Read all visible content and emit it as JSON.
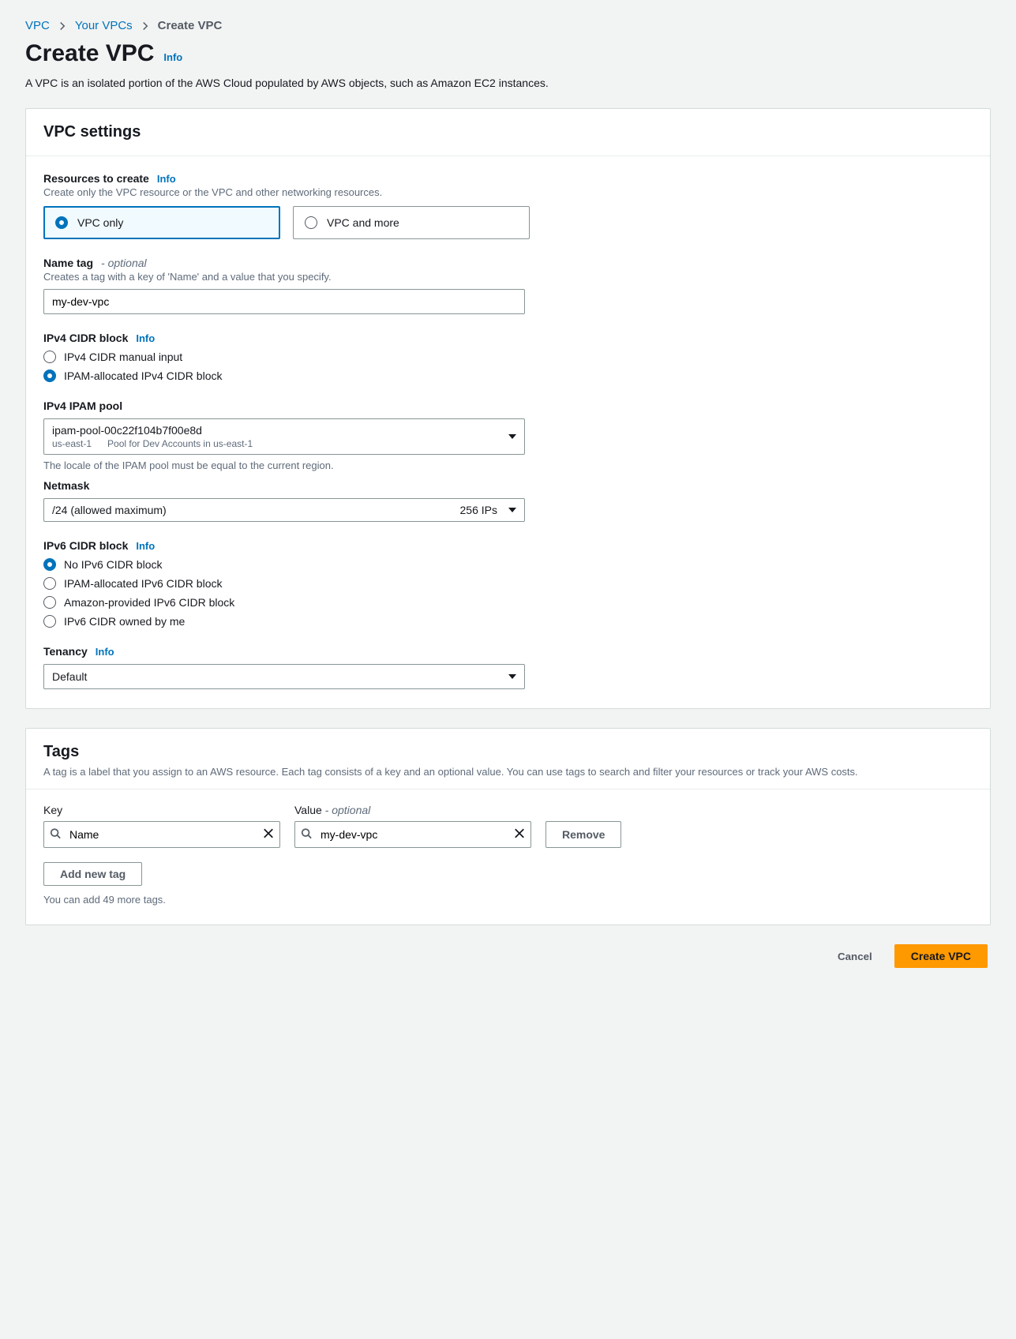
{
  "breadcrumb": {
    "items": [
      "VPC",
      "Your VPCs",
      "Create VPC"
    ]
  },
  "header": {
    "title": "Create VPC",
    "info": "Info",
    "description": "A VPC is an isolated portion of the AWS Cloud populated by AWS objects, such as Amazon EC2 instances."
  },
  "settings": {
    "panel_title": "VPC settings",
    "resources": {
      "label": "Resources to create",
      "info": "Info",
      "hint": "Create only the VPC resource or the VPC and other networking resources.",
      "option_vpc_only": "VPC only",
      "option_vpc_more": "VPC and more"
    },
    "name_tag": {
      "label": "Name tag",
      "optional": "- optional",
      "hint": "Creates a tag with a key of 'Name' and a value that you specify.",
      "value": "my-dev-vpc"
    },
    "ipv4_block": {
      "label": "IPv4 CIDR block",
      "info": "Info",
      "option_manual": "IPv4 CIDR manual input",
      "option_ipam": "IPAM-allocated IPv4 CIDR block"
    },
    "ipam_pool": {
      "label": "IPv4 IPAM pool",
      "selected_id": "ipam-pool-00c22f104b7f00e8d",
      "region": "us-east-1",
      "description": "Pool for Dev Accounts in us-east-1",
      "constraint": "The locale of the IPAM pool must be equal to the current region."
    },
    "netmask": {
      "label": "Netmask",
      "value": "/24 (allowed maximum)",
      "ips": "256 IPs"
    },
    "ipv6_block": {
      "label": "IPv6 CIDR block",
      "info": "Info",
      "option_none": "No IPv6 CIDR block",
      "option_ipam": "IPAM-allocated IPv6 CIDR block",
      "option_amazon": "Amazon-provided IPv6 CIDR block",
      "option_owned": "IPv6 CIDR owned by me"
    },
    "tenancy": {
      "label": "Tenancy",
      "info": "Info",
      "value": "Default"
    }
  },
  "tags": {
    "panel_title": "Tags",
    "description": "A tag is a label that you assign to an AWS resource. Each tag consists of a key and an optional value. You can use tags to search and filter your resources or track your AWS costs.",
    "key_label": "Key",
    "value_label": "Value",
    "value_optional": "- optional",
    "row": {
      "key": "Name",
      "value": "my-dev-vpc"
    },
    "remove": "Remove",
    "add_new": "Add new tag",
    "limit": "You can add 49 more tags."
  },
  "footer": {
    "cancel": "Cancel",
    "submit": "Create VPC"
  }
}
